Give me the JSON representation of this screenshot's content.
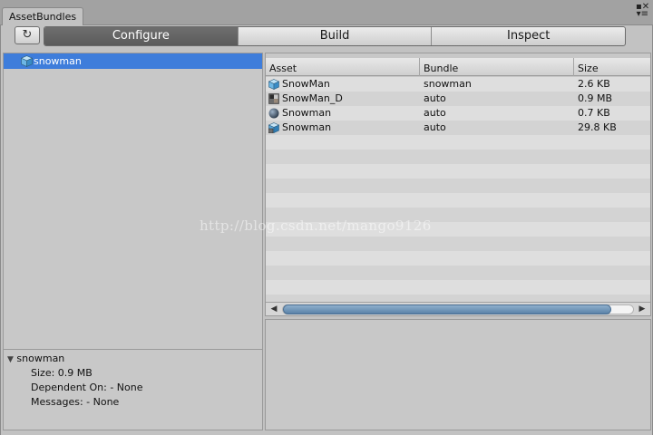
{
  "window": {
    "tab_label": "AssetBundles",
    "window_icons": "▪✕ ▾≡"
  },
  "toolbar": {
    "refresh_icon": "↻",
    "tabs": [
      "Configure",
      "Build",
      "Inspect"
    ],
    "active_tab": "Configure"
  },
  "tree": {
    "items": [
      {
        "label": "snowman",
        "icon": "cube-icon",
        "selected": true
      }
    ]
  },
  "assets": {
    "columns": [
      "Asset",
      "Bundle",
      "Size"
    ],
    "rows": [
      {
        "icon": "cube-icon",
        "asset": "SnowMan",
        "bundle": "snowman",
        "size": "2.6 KB"
      },
      {
        "icon": "texture-icon",
        "asset": "SnowMan_D",
        "bundle": "auto",
        "size": "0.9 MB"
      },
      {
        "icon": "material-sphere-icon",
        "asset": "Snowman",
        "bundle": "auto",
        "size": "0.7 KB"
      },
      {
        "icon": "mesh-icon",
        "asset": "Snowman",
        "bundle": "auto",
        "size": "29.8 KB"
      }
    ],
    "scroll_left_icon": "◀",
    "scroll_right_icon": "▶"
  },
  "info": {
    "expand_icon": "▼",
    "title": "snowman",
    "lines": [
      "Size: 0.9 MB",
      "Dependent On: - None",
      "Messages: - None"
    ]
  },
  "watermark": "http://blog.csdn.net/mango9126",
  "colors": {
    "selection": "#3e7ddb",
    "active_tab": "#5f5f5f",
    "scroll_thumb": "#6c8fb3"
  }
}
